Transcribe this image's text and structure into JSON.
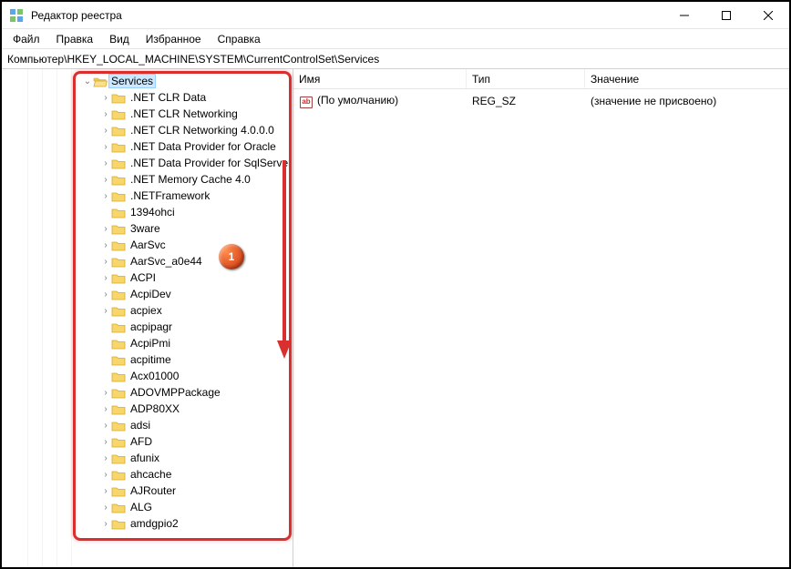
{
  "window": {
    "title": "Редактор реестра"
  },
  "menu": {
    "file": "Файл",
    "edit": "Правка",
    "view": "Вид",
    "favorites": "Избранное",
    "help": "Справка"
  },
  "address": {
    "path": "Компьютер\\HKEY_LOCAL_MACHINE\\SYSTEM\\CurrentControlSet\\Services"
  },
  "tree": {
    "root": {
      "label": "Services"
    },
    "items": [
      {
        "label": ".NET CLR Data",
        "expandable": true
      },
      {
        "label": ".NET CLR Networking",
        "expandable": true
      },
      {
        "label": ".NET CLR Networking 4.0.0.0",
        "expandable": true
      },
      {
        "label": ".NET Data Provider for Oracle",
        "expandable": true
      },
      {
        "label": ".NET Data Provider for SqlServer",
        "expandable": true
      },
      {
        "label": ".NET Memory Cache 4.0",
        "expandable": true
      },
      {
        "label": ".NETFramework",
        "expandable": true
      },
      {
        "label": "1394ohci",
        "expandable": false
      },
      {
        "label": "3ware",
        "expandable": true
      },
      {
        "label": "AarSvc",
        "expandable": true
      },
      {
        "label": "AarSvc_a0e44",
        "expandable": true
      },
      {
        "label": "ACPI",
        "expandable": true
      },
      {
        "label": "AcpiDev",
        "expandable": true
      },
      {
        "label": "acpiex",
        "expandable": true
      },
      {
        "label": "acpipagr",
        "expandable": false
      },
      {
        "label": "AcpiPmi",
        "expandable": false
      },
      {
        "label": "acpitime",
        "expandable": false
      },
      {
        "label": "Acx01000",
        "expandable": false
      },
      {
        "label": "ADOVMPPackage",
        "expandable": true
      },
      {
        "label": "ADP80XX",
        "expandable": true
      },
      {
        "label": "adsi",
        "expandable": true
      },
      {
        "label": "AFD",
        "expandable": true
      },
      {
        "label": "afunix",
        "expandable": true
      },
      {
        "label": "ahcache",
        "expandable": true
      },
      {
        "label": "AJRouter",
        "expandable": true
      },
      {
        "label": "ALG",
        "expandable": true
      },
      {
        "label": "amdgpio2",
        "expandable": true
      }
    ]
  },
  "list": {
    "headers": {
      "name": "Имя",
      "type": "Тип",
      "value": "Значение"
    },
    "rows": [
      {
        "name": "(По умолчанию)",
        "type": "REG_SZ",
        "value": "(значение не присвоено)",
        "icon_text": "ab"
      }
    ]
  },
  "callout": {
    "number": "1"
  }
}
